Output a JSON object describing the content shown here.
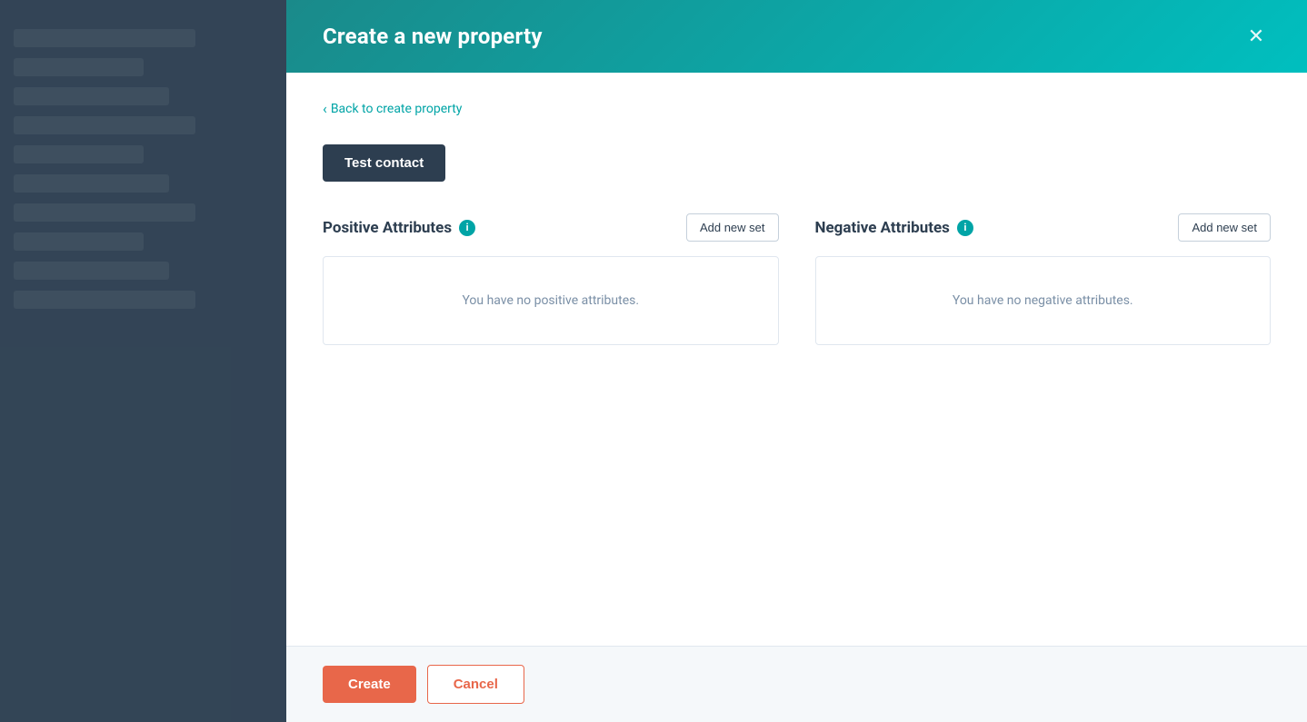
{
  "modal": {
    "title": "Create a new property",
    "close_label": "✕"
  },
  "back_link": {
    "label": "Back to create property",
    "arrow": "‹"
  },
  "test_contact_button": {
    "label": "Test contact"
  },
  "positive_attributes": {
    "title": "Positive Attributes",
    "info_icon": "i",
    "add_button_label": "Add new set",
    "empty_message": "You have no positive attributes."
  },
  "negative_attributes": {
    "title": "Negative Attributes",
    "info_icon": "i",
    "add_button_label": "Add new set",
    "empty_message": "You have no negative attributes."
  },
  "footer": {
    "create_label": "Create",
    "cancel_label": "Cancel"
  },
  "colors": {
    "header_gradient_start": "#1a8a8a",
    "header_gradient_end": "#00bfbf",
    "accent": "#00a4a6",
    "create_btn": "#e8674a",
    "dark_bg": "#2d3e50"
  }
}
